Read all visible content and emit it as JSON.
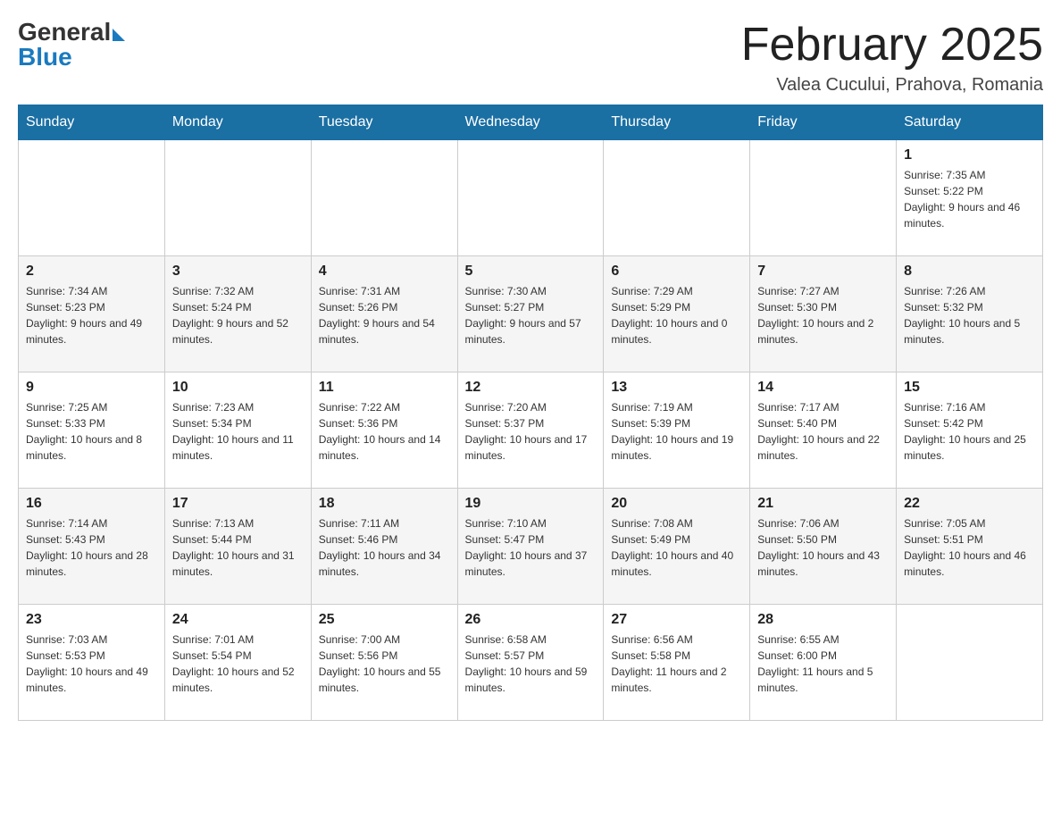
{
  "header": {
    "logo_general": "General",
    "logo_blue": "Blue",
    "month_title": "February 2025",
    "location": "Valea Cucului, Prahova, Romania"
  },
  "weekdays": [
    "Sunday",
    "Monday",
    "Tuesday",
    "Wednesday",
    "Thursday",
    "Friday",
    "Saturday"
  ],
  "weeks": [
    {
      "days": [
        {
          "number": "",
          "info": ""
        },
        {
          "number": "",
          "info": ""
        },
        {
          "number": "",
          "info": ""
        },
        {
          "number": "",
          "info": ""
        },
        {
          "number": "",
          "info": ""
        },
        {
          "number": "",
          "info": ""
        },
        {
          "number": "1",
          "info": "Sunrise: 7:35 AM\nSunset: 5:22 PM\nDaylight: 9 hours and 46 minutes."
        }
      ]
    },
    {
      "days": [
        {
          "number": "2",
          "info": "Sunrise: 7:34 AM\nSunset: 5:23 PM\nDaylight: 9 hours and 49 minutes."
        },
        {
          "number": "3",
          "info": "Sunrise: 7:32 AM\nSunset: 5:24 PM\nDaylight: 9 hours and 52 minutes."
        },
        {
          "number": "4",
          "info": "Sunrise: 7:31 AM\nSunset: 5:26 PM\nDaylight: 9 hours and 54 minutes."
        },
        {
          "number": "5",
          "info": "Sunrise: 7:30 AM\nSunset: 5:27 PM\nDaylight: 9 hours and 57 minutes."
        },
        {
          "number": "6",
          "info": "Sunrise: 7:29 AM\nSunset: 5:29 PM\nDaylight: 10 hours and 0 minutes."
        },
        {
          "number": "7",
          "info": "Sunrise: 7:27 AM\nSunset: 5:30 PM\nDaylight: 10 hours and 2 minutes."
        },
        {
          "number": "8",
          "info": "Sunrise: 7:26 AM\nSunset: 5:32 PM\nDaylight: 10 hours and 5 minutes."
        }
      ]
    },
    {
      "days": [
        {
          "number": "9",
          "info": "Sunrise: 7:25 AM\nSunset: 5:33 PM\nDaylight: 10 hours and 8 minutes."
        },
        {
          "number": "10",
          "info": "Sunrise: 7:23 AM\nSunset: 5:34 PM\nDaylight: 10 hours and 11 minutes."
        },
        {
          "number": "11",
          "info": "Sunrise: 7:22 AM\nSunset: 5:36 PM\nDaylight: 10 hours and 14 minutes."
        },
        {
          "number": "12",
          "info": "Sunrise: 7:20 AM\nSunset: 5:37 PM\nDaylight: 10 hours and 17 minutes."
        },
        {
          "number": "13",
          "info": "Sunrise: 7:19 AM\nSunset: 5:39 PM\nDaylight: 10 hours and 19 minutes."
        },
        {
          "number": "14",
          "info": "Sunrise: 7:17 AM\nSunset: 5:40 PM\nDaylight: 10 hours and 22 minutes."
        },
        {
          "number": "15",
          "info": "Sunrise: 7:16 AM\nSunset: 5:42 PM\nDaylight: 10 hours and 25 minutes."
        }
      ]
    },
    {
      "days": [
        {
          "number": "16",
          "info": "Sunrise: 7:14 AM\nSunset: 5:43 PM\nDaylight: 10 hours and 28 minutes."
        },
        {
          "number": "17",
          "info": "Sunrise: 7:13 AM\nSunset: 5:44 PM\nDaylight: 10 hours and 31 minutes."
        },
        {
          "number": "18",
          "info": "Sunrise: 7:11 AM\nSunset: 5:46 PM\nDaylight: 10 hours and 34 minutes."
        },
        {
          "number": "19",
          "info": "Sunrise: 7:10 AM\nSunset: 5:47 PM\nDaylight: 10 hours and 37 minutes."
        },
        {
          "number": "20",
          "info": "Sunrise: 7:08 AM\nSunset: 5:49 PM\nDaylight: 10 hours and 40 minutes."
        },
        {
          "number": "21",
          "info": "Sunrise: 7:06 AM\nSunset: 5:50 PM\nDaylight: 10 hours and 43 minutes."
        },
        {
          "number": "22",
          "info": "Sunrise: 7:05 AM\nSunset: 5:51 PM\nDaylight: 10 hours and 46 minutes."
        }
      ]
    },
    {
      "days": [
        {
          "number": "23",
          "info": "Sunrise: 7:03 AM\nSunset: 5:53 PM\nDaylight: 10 hours and 49 minutes."
        },
        {
          "number": "24",
          "info": "Sunrise: 7:01 AM\nSunset: 5:54 PM\nDaylight: 10 hours and 52 minutes."
        },
        {
          "number": "25",
          "info": "Sunrise: 7:00 AM\nSunset: 5:56 PM\nDaylight: 10 hours and 55 minutes."
        },
        {
          "number": "26",
          "info": "Sunrise: 6:58 AM\nSunset: 5:57 PM\nDaylight: 10 hours and 59 minutes."
        },
        {
          "number": "27",
          "info": "Sunrise: 6:56 AM\nSunset: 5:58 PM\nDaylight: 11 hours and 2 minutes."
        },
        {
          "number": "28",
          "info": "Sunrise: 6:55 AM\nSunset: 6:00 PM\nDaylight: 11 hours and 5 minutes."
        },
        {
          "number": "",
          "info": ""
        }
      ]
    }
  ]
}
